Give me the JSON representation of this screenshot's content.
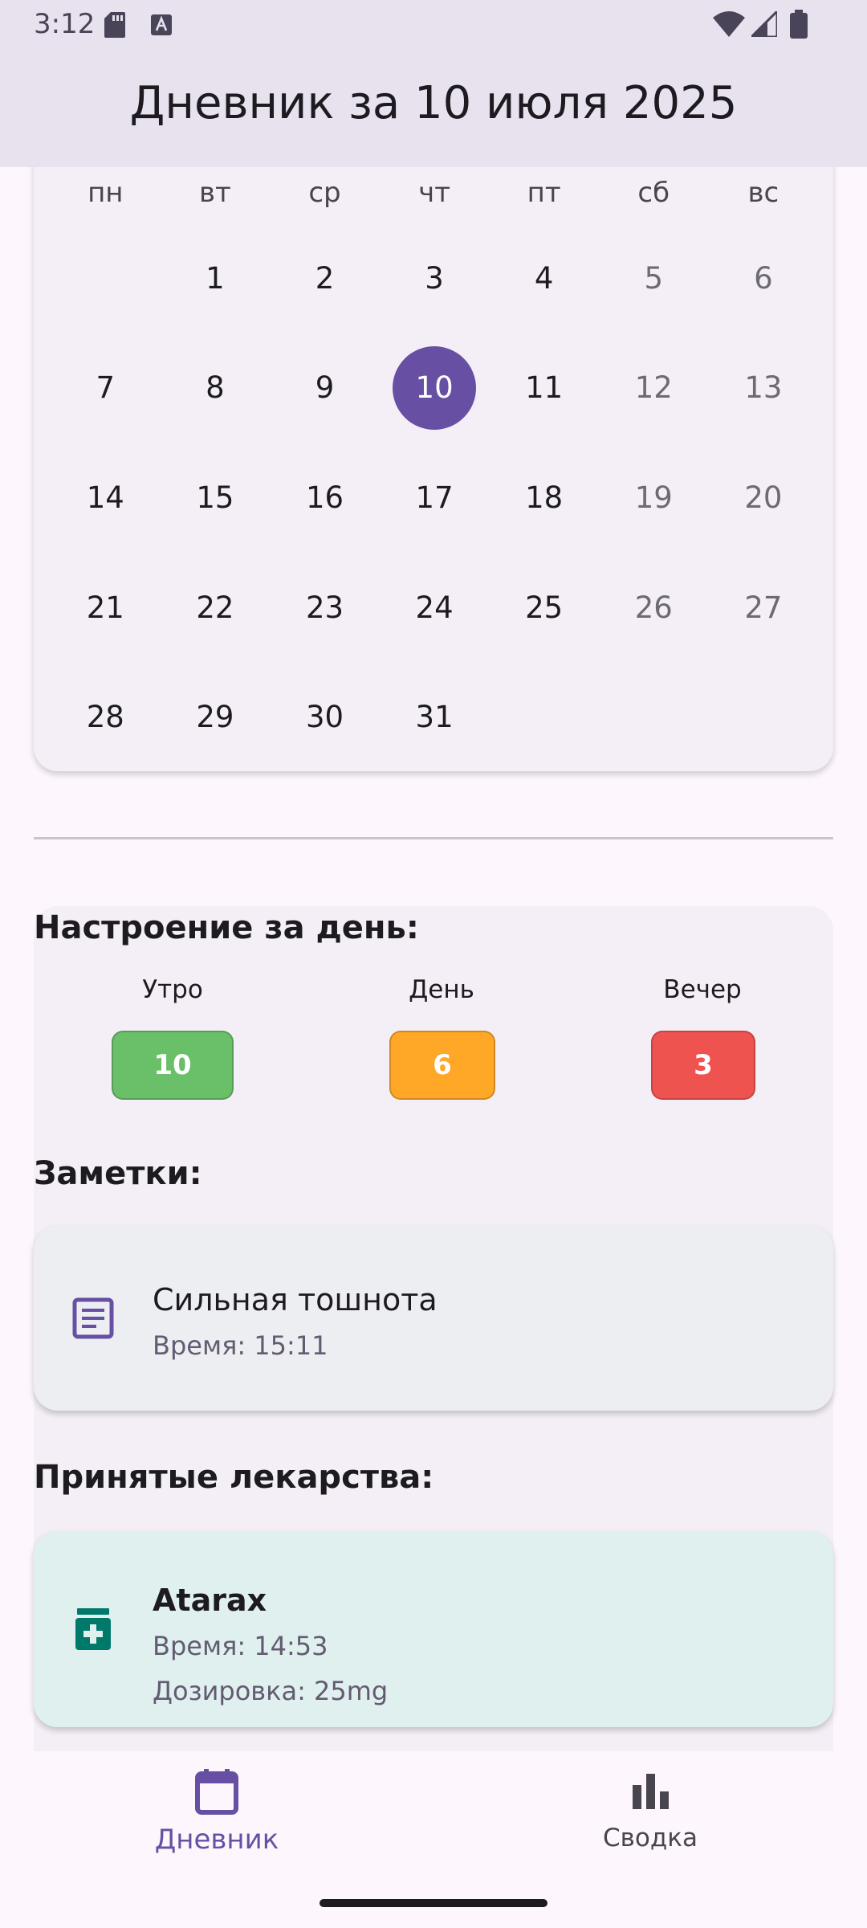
{
  "status_bar": {
    "time": "3:12"
  },
  "app_bar": {
    "title": "Дневник за 10 июля 2025"
  },
  "calendar": {
    "weekdays": [
      "пн",
      "вт",
      "ср",
      "чт",
      "пт",
      "сб",
      "вс"
    ],
    "selected_day": "10",
    "accent_color": "#6750a4"
  },
  "mood": {
    "title": "Настроение за день:",
    "morning": {
      "label": "Утро",
      "value": "10",
      "color": "#6abf69"
    },
    "day": {
      "label": "День",
      "value": "6",
      "color": "#ffa726"
    },
    "evening": {
      "label": "Вечер",
      "value": "3",
      "color": "#ef5350"
    }
  },
  "notes": {
    "title": "Заметки:",
    "items": [
      {
        "text": "Сильная тошнота",
        "time": "Время: 15:11",
        "icon": "notes-icon"
      }
    ]
  },
  "medicines": {
    "title": "Принятые лекарства:",
    "items": [
      {
        "name": "Atarax",
        "time": "Время: 14:53",
        "dosage": "Дозировка: 25mg",
        "icon": "medication-icon"
      }
    ]
  },
  "bottom_nav": {
    "diary_label": "Дневник",
    "summary_label": "Сводка"
  }
}
